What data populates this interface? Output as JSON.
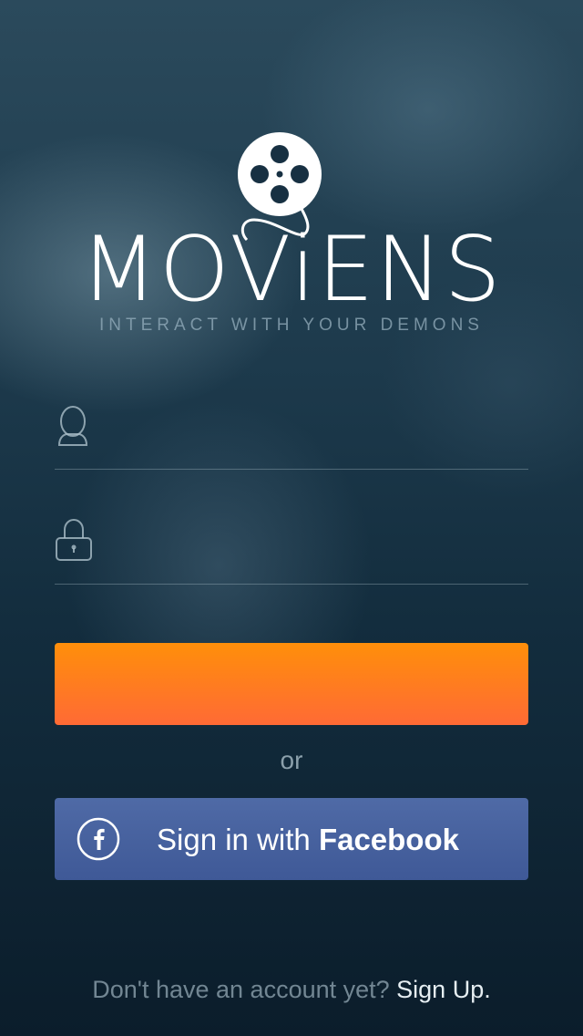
{
  "brand": {
    "name": "MOViENS",
    "tagline": "INTERACT WITH YOUR DEMONS",
    "logo_icon": "film-reel-icon"
  },
  "form": {
    "username_icon": "user-icon",
    "username_placeholder": "",
    "password_icon": "lock-icon",
    "password_placeholder": "",
    "login_label": ""
  },
  "divider": {
    "or_text": "or"
  },
  "facebook": {
    "icon": "facebook-icon",
    "label_prefix": "Sign in with ",
    "label_bold": "Facebook"
  },
  "footer": {
    "prompt": "Don't have an account yet? ",
    "signup_link": "Sign Up."
  },
  "colors": {
    "login_button_top": "#ff8f0a",
    "login_button_bottom": "#ff6a35",
    "facebook_button": "#4661a0"
  }
}
